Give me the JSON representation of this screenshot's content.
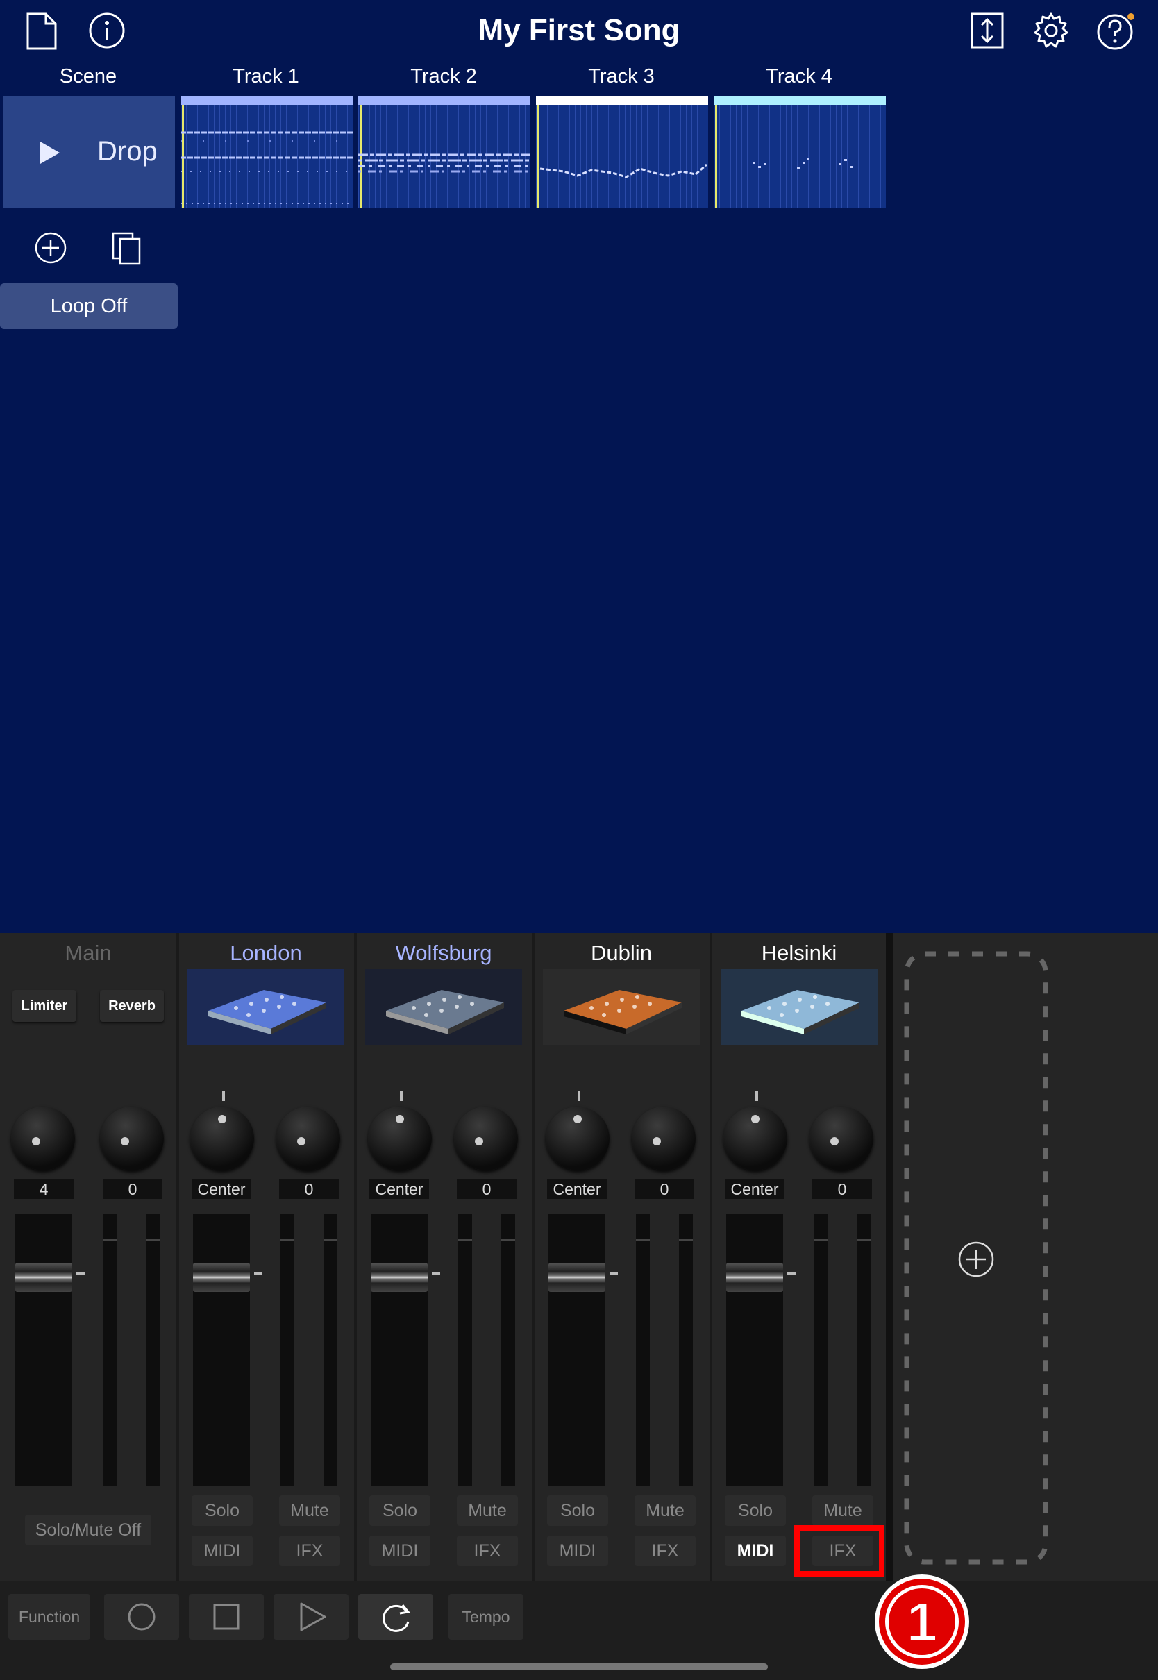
{
  "header": {
    "title": "My First Song",
    "icons": [
      "new-document-icon",
      "info-icon",
      "import-export-icon",
      "settings-gear-icon",
      "help-icon"
    ]
  },
  "grid": {
    "scene_header": "Scene",
    "tracks": [
      {
        "label": "Track 1",
        "color": "#a0b4ff"
      },
      {
        "label": "Track 2",
        "color": "#a0b4ff"
      },
      {
        "label": "Track 3",
        "color": "#ffffff"
      },
      {
        "label": "Track 4",
        "color": "#aef0ff"
      }
    ],
    "scene": {
      "name": "Drop"
    },
    "loop_label": "Loop Off"
  },
  "mixer": {
    "main": {
      "name": "Main",
      "fx1": "Limiter",
      "fx2": "Reverb",
      "value1": "4",
      "value2": "0",
      "solo_mute_label": "Solo/Mute Off"
    },
    "channels": [
      {
        "name": "London",
        "name_color": "#a7b4ff",
        "pan": "Center",
        "send": "0",
        "solo": "Solo",
        "mute": "Mute",
        "midi": "MIDI",
        "ifx": "IFX"
      },
      {
        "name": "Wolfsburg",
        "name_color": "#a7b4ff",
        "pan": "Center",
        "send": "0",
        "solo": "Solo",
        "mute": "Mute",
        "midi": "MIDI",
        "ifx": "IFX"
      },
      {
        "name": "Dublin",
        "name_color": "#ffffff",
        "pan": "Center",
        "send": "0",
        "solo": "Solo",
        "mute": "Mute",
        "midi": "MIDI",
        "ifx": "IFX"
      },
      {
        "name": "Helsinki",
        "name_color": "#ffffff",
        "pan": "Center",
        "send": "0",
        "solo": "Solo",
        "mute": "Mute",
        "midi": "MIDI",
        "ifx": "IFX"
      }
    ],
    "active_midi_channel": "Helsinki"
  },
  "transport": {
    "function_label": "Function",
    "tempo_label": "Tempo"
  },
  "annotation": {
    "marker": "1",
    "highlight_color": "#ff0000"
  }
}
